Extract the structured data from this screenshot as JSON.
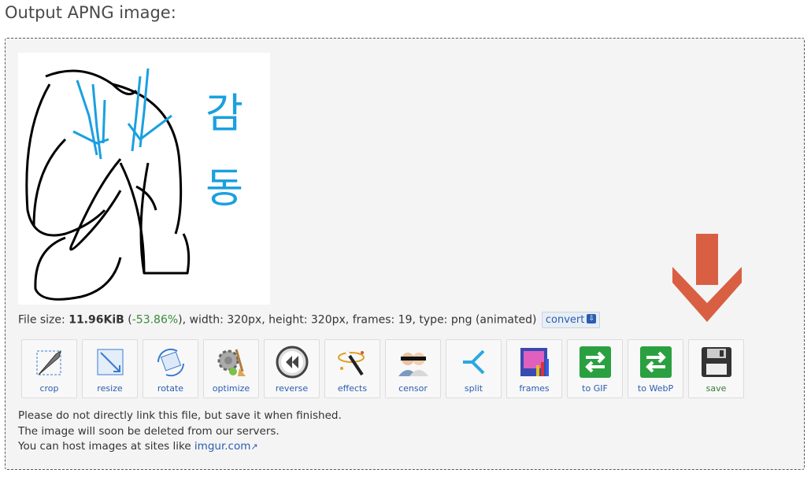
{
  "page": {
    "title": "Output APNG image:"
  },
  "image_text": [
    "감",
    "동"
  ],
  "info": {
    "file_size_label": "File size: ",
    "file_size_value": "11.96KiB",
    "pct_open": " (",
    "pct_value": "-53.86%",
    "pct_close": "), ",
    "width_text": "width: 320px, ",
    "height_text": "height: 320px, ",
    "frames_text": "frames: 19, ",
    "type_text": "type: png (animated)",
    "convert_label": "convert"
  },
  "tools": [
    {
      "label": "crop",
      "icon": "crop-icon"
    },
    {
      "label": "resize",
      "icon": "resize-icon"
    },
    {
      "label": "rotate",
      "icon": "rotate-icon"
    },
    {
      "label": "optimize",
      "icon": "optimize-icon"
    },
    {
      "label": "reverse",
      "icon": "reverse-icon"
    },
    {
      "label": "effects",
      "icon": "effects-icon"
    },
    {
      "label": "censor",
      "icon": "censor-icon"
    },
    {
      "label": "split",
      "icon": "split-icon"
    },
    {
      "label": "frames",
      "icon": "frames-icon"
    },
    {
      "label": "to GIF",
      "icon": "to-gif-icon"
    },
    {
      "label": "to WebP",
      "icon": "to-webp-icon"
    },
    {
      "label": "save",
      "icon": "save-icon"
    }
  ],
  "notes": {
    "line1": "Please do not directly link this file, but save it when finished.",
    "line2": "The image will soon be deleted from our servers.",
    "line3_prefix": "You can host images at sites like ",
    "line3_link": "imgur.com"
  },
  "colors": {
    "accent": "#2a5db0",
    "arrow": "#d95f43",
    "positive": "#3a8a3a",
    "drawing_blue": "#1aa0e0"
  }
}
